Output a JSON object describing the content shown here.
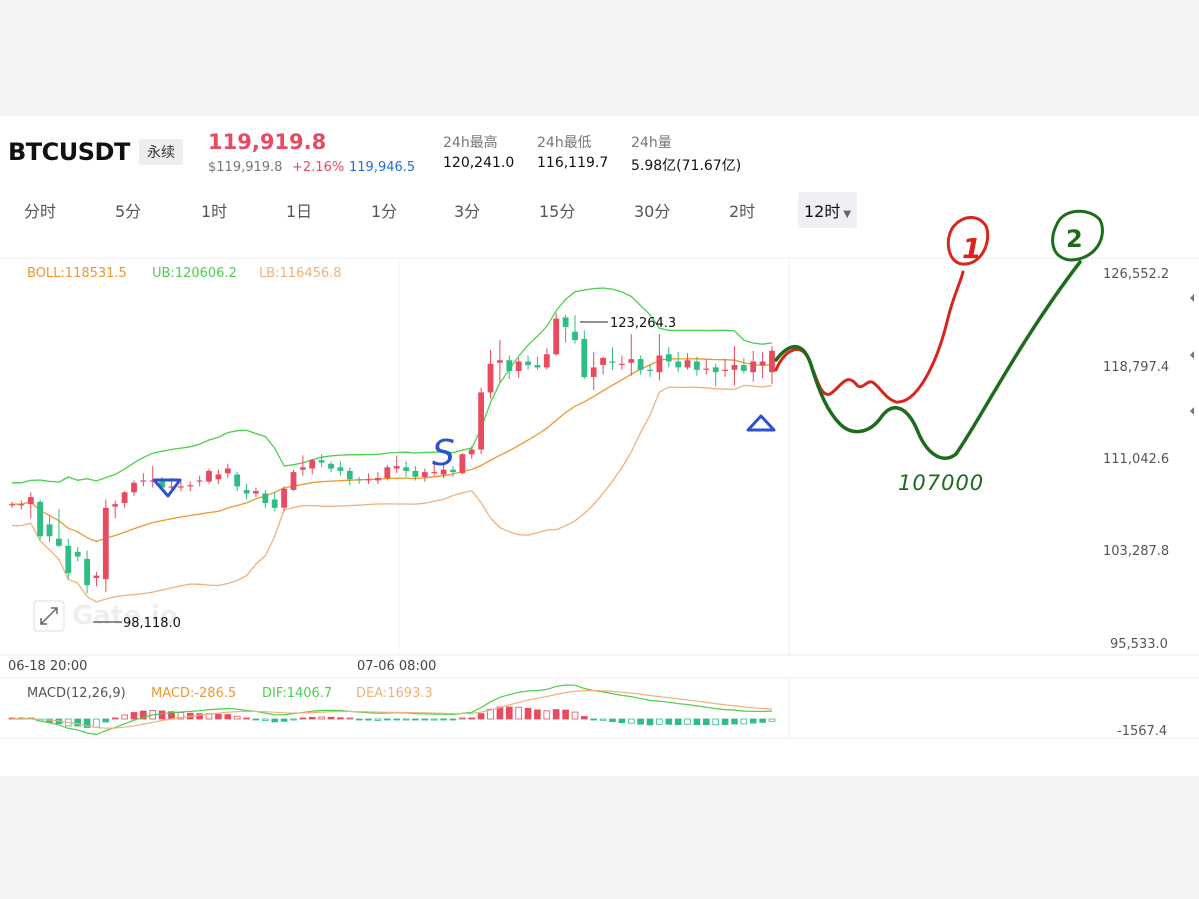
{
  "header": {
    "symbol": "BTCUSDT",
    "contract_tag": "永续",
    "last_price": "119,919.8",
    "usd_price": "$119,919.8",
    "change_pct": "+2.16%",
    "mark_price": "119,946.5",
    "stats": [
      {
        "label": "24h最高",
        "value": "120,241.0"
      },
      {
        "label": "24h最低",
        "value": "116,119.7"
      },
      {
        "label": "24h量",
        "value": "5.98亿(71.67亿)"
      }
    ]
  },
  "timeframes": [
    "分时",
    "5分",
    "1时",
    "1日",
    "1分",
    "3分",
    "15分",
    "30分",
    "2时",
    "12时"
  ],
  "active_timeframe": "12时",
  "indicators": {
    "boll": "BOLL:118531.5",
    "ub": "UB:120606.2",
    "lb": "LB:116456.8",
    "macd_params": "MACD(12,26,9)",
    "macd": "MACD:-286.5",
    "dif": "DIF:1406.7",
    "dea": "DEA:1693.3"
  },
  "chart": {
    "price_axis": [
      "126,552.2",
      "118,797.4",
      "111,042.6",
      "103,287.8",
      "95,533.0"
    ],
    "time_axis": [
      "06-18 20:00",
      "07-06 08:00"
    ],
    "macd_axis": "-1567.4",
    "high_marker": "123,264.3",
    "low_marker": "98,118.0",
    "watermark": "Gate.io",
    "annotation_target": "107000",
    "annotation_labels": [
      "1",
      "2",
      "S"
    ]
  },
  "colors": {
    "up": "#e84a5f",
    "down": "#2ebd85",
    "boll_mid": "#f0962f",
    "boll_ub": "#4bd04b",
    "boll_lb": "#f2b07a",
    "hand_red": "#d8261c",
    "hand_green": "#1d6b1d",
    "hand_blue": "#2d52c9"
  },
  "chart_data": {
    "type": "candlestick",
    "ylim": [
      95533.0,
      126552.2
    ],
    "candles": [
      [
        107200,
        107400,
        106900,
        107200
      ],
      [
        107200,
        107500,
        106800,
        107200
      ],
      [
        107200,
        108200,
        106000,
        107800
      ],
      [
        107400,
        107600,
        104200,
        104500
      ],
      [
        105500,
        106200,
        104000,
        104500
      ],
      [
        104300,
        106800,
        103600,
        103700
      ],
      [
        103700,
        104300,
        100900,
        101400
      ],
      [
        103200,
        103600,
        102400,
        102800
      ],
      [
        102600,
        103300,
        99700,
        100400
      ],
      [
        101000,
        101500,
        100300,
        101200
      ],
      [
        100900,
        107600,
        99800,
        106900
      ],
      [
        107000,
        107500,
        106000,
        107200
      ],
      [
        107300,
        108300,
        106900,
        108200
      ],
      [
        108200,
        109200,
        107900,
        109000
      ],
      [
        109200,
        109800,
        108700,
        109200
      ],
      [
        109100,
        110400,
        108600,
        109200
      ],
      [
        109100,
        109500,
        108400,
        108600
      ],
      [
        108700,
        109400,
        108100,
        108700
      ],
      [
        108700,
        109300,
        108300,
        108700
      ],
      [
        108700,
        109100,
        108300,
        108800
      ],
      [
        109100,
        109600,
        108700,
        109200
      ],
      [
        109100,
        110200,
        108900,
        110000
      ],
      [
        109300,
        110100,
        108900,
        109700
      ],
      [
        109800,
        110600,
        109400,
        110200
      ],
      [
        109700,
        109900,
        108300,
        108700
      ],
      [
        108400,
        108900,
        107600,
        108100
      ],
      [
        108100,
        108600,
        107800,
        108300
      ],
      [
        108100,
        108400,
        106900,
        107300
      ],
      [
        107600,
        108200,
        106600,
        106900
      ],
      [
        106900,
        108700,
        106600,
        108500
      ],
      [
        108400,
        110100,
        108300,
        109900
      ],
      [
        110100,
        111300,
        109600,
        110300
      ],
      [
        110200,
        111000,
        109700,
        110900
      ],
      [
        110900,
        111400,
        110300,
        110700
      ],
      [
        110600,
        110800,
        109900,
        110200
      ],
      [
        110300,
        110800,
        109600,
        110000
      ],
      [
        110000,
        110300,
        108800,
        109300
      ],
      [
        109300,
        109500,
        108900,
        109200
      ],
      [
        109200,
        109800,
        108900,
        109300
      ],
      [
        109200,
        109900,
        108900,
        109400
      ],
      [
        109400,
        110500,
        109200,
        110300
      ],
      [
        110200,
        111300,
        109800,
        110400
      ],
      [
        110300,
        110800,
        109500,
        110000
      ],
      [
        110000,
        110400,
        109200,
        109500
      ],
      [
        109500,
        110200,
        109100,
        109900
      ],
      [
        109900,
        110700,
        109600,
        109900
      ],
      [
        109700,
        110600,
        109400,
        110100
      ],
      [
        110100,
        110400,
        109500,
        109900
      ],
      [
        109800,
        111500,
        109700,
        111400
      ],
      [
        111400,
        112100,
        111000,
        111800
      ],
      [
        111800,
        117000,
        111400,
        116600
      ],
      [
        116600,
        120200,
        116100,
        119000
      ],
      [
        119100,
        121000,
        117500,
        119300
      ],
      [
        119300,
        119700,
        117700,
        118400
      ],
      [
        118400,
        119500,
        117800,
        119200
      ],
      [
        119200,
        119700,
        118500,
        118900
      ],
      [
        118900,
        119600,
        118500,
        118700
      ],
      [
        118700,
        120300,
        118500,
        119800
      ],
      [
        119800,
        123264,
        119700,
        122800
      ],
      [
        122900,
        123100,
        120800,
        122100
      ],
      [
        121700,
        123100,
        120700,
        121000
      ],
      [
        121100,
        121800,
        117700,
        117900
      ],
      [
        117900,
        120000,
        116800,
        118700
      ],
      [
        118900,
        119600,
        118100,
        119500
      ],
      [
        119200,
        120400,
        118500,
        119100
      ],
      [
        119000,
        119700,
        118500,
        119000
      ],
      [
        119100,
        121500,
        118000,
        119400
      ],
      [
        119400,
        119700,
        118100,
        118500
      ],
      [
        118500,
        119000,
        117900,
        118400
      ],
      [
        118300,
        121500,
        117600,
        119700
      ],
      [
        119800,
        120400,
        118700,
        119200
      ],
      [
        119200,
        120000,
        118300,
        118700
      ],
      [
        118700,
        119900,
        118500,
        119300
      ],
      [
        119200,
        119600,
        118000,
        118500
      ],
      [
        118500,
        119400,
        118100,
        118600
      ],
      [
        118700,
        119000,
        117100,
        118300
      ],
      [
        118400,
        119400,
        117900,
        118500
      ],
      [
        118500,
        120500,
        117200,
        118900
      ],
      [
        118900,
        119500,
        118200,
        118400
      ],
      [
        118300,
        120100,
        117500,
        119200
      ],
      [
        118900,
        120000,
        117800,
        119200
      ],
      [
        118300,
        120500,
        117300,
        120100
      ]
    ]
  }
}
